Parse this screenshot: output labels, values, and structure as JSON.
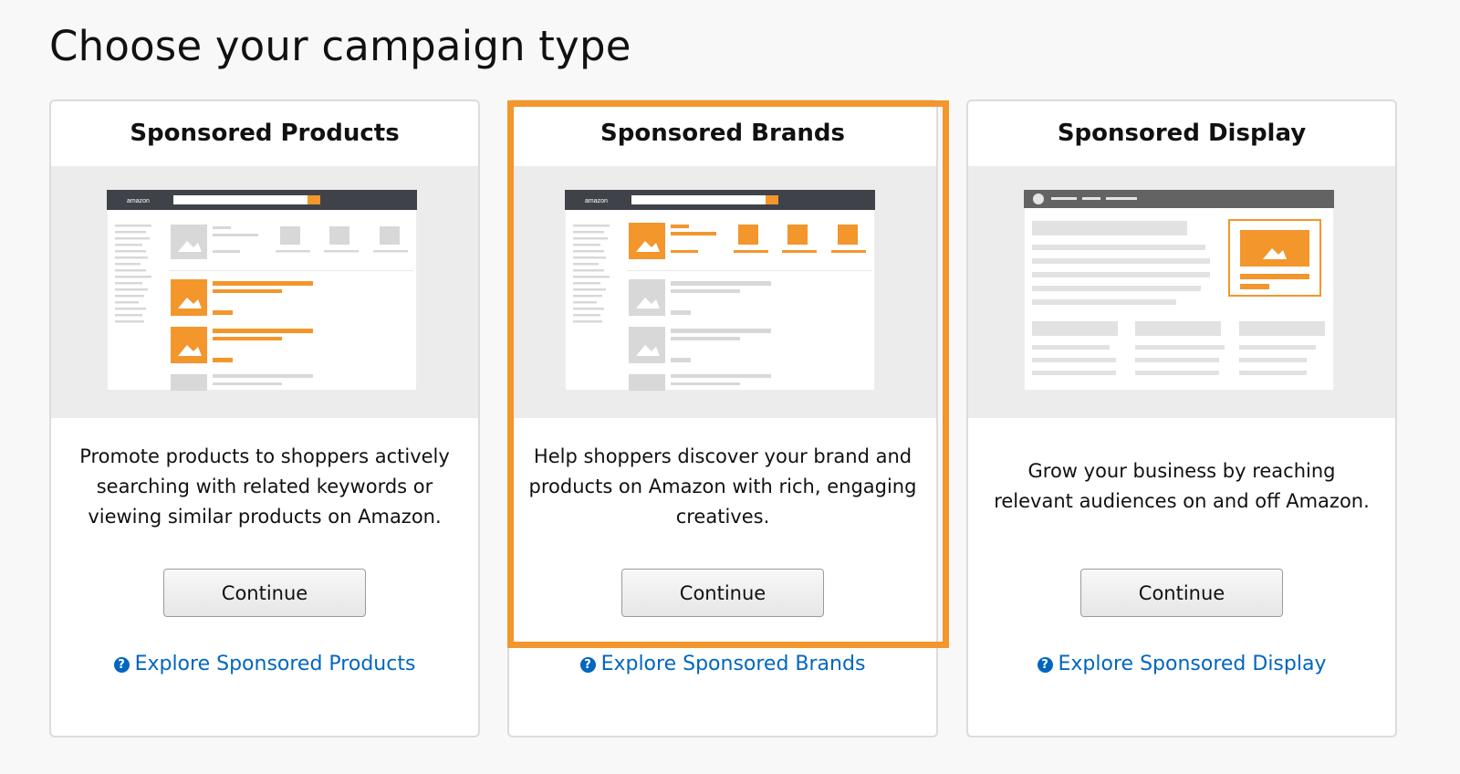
{
  "page": {
    "title": "Choose your campaign type"
  },
  "cards": [
    {
      "title": "Sponsored Products",
      "description": "Promote products to shoppers actively searching with related keywords or viewing similar products on Amazon.",
      "button_label": "Continue",
      "explore_label": "Explore Sponsored Products",
      "selected": false
    },
    {
      "title": "Sponsored Brands",
      "description": "Help shoppers discover your brand and products on Amazon with rich, engaging creatives.",
      "button_label": "Continue",
      "explore_label": "Explore Sponsored Brands",
      "selected": true
    },
    {
      "title": "Sponsored Display",
      "description": "Grow your business by reaching relevant audiences on and off Amazon.",
      "button_label": "Continue",
      "explore_label": "Explore Sponsored Display",
      "selected": false
    }
  ],
  "illustration": {
    "logo_text": "amazon"
  },
  "colors": {
    "accent_orange": "#f3962c",
    "link_blue": "#0066c0",
    "placeholder_gray": "#d8d8d8",
    "header_dark": "#3f4349"
  }
}
